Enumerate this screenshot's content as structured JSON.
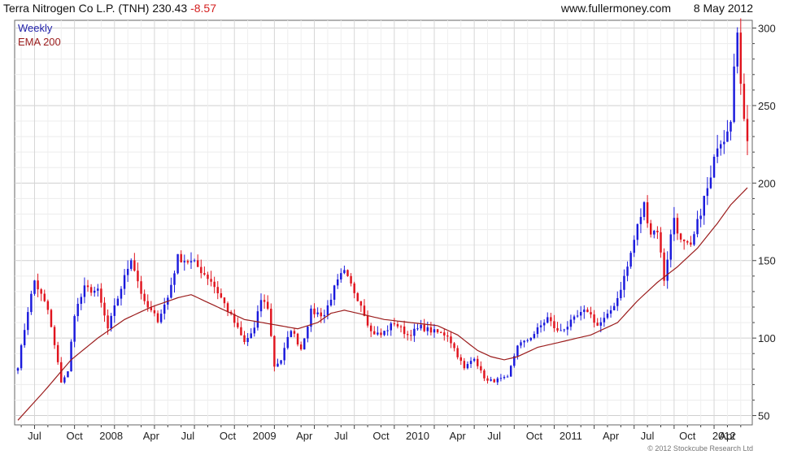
{
  "header": {
    "title": "Terra Nitrogen Co L.P. (TNH) 230.43",
    "change": "-8.57",
    "source": "www.fullermoney.com",
    "date": "8 May 2012"
  },
  "legend": {
    "weekly_label": "Weekly",
    "ema_label": "EMA 200"
  },
  "footer": {
    "copyright": "© 2012 Stockcube Research Ltd"
  },
  "colors": {
    "up": "#1a1adc",
    "down": "#e0141e",
    "ema": "#9b1c1c",
    "grid": "#d9d9d9",
    "axis": "#444444",
    "title_neg": "#d42020",
    "legend_weekly": "#2222aa",
    "legend_ema": "#9b1c1c"
  },
  "chart_data": {
    "type": "candlestick",
    "y_axis": {
      "min": 44,
      "max": 305,
      "ticks": [
        50,
        100,
        150,
        200,
        250,
        300
      ],
      "position": "right"
    },
    "x_axis": {
      "ticks": [
        "Jul",
        "Oct",
        "2008",
        "Apr",
        "Jul",
        "Oct",
        "2009",
        "Apr",
        "Jul",
        "Oct",
        "2010",
        "Apr",
        "Jul",
        "Oct",
        "2011",
        "Apr",
        "Jul",
        "Oct",
        "2012",
        "Apr"
      ]
    },
    "grid": true,
    "series": [
      {
        "name": "Weekly",
        "kind": "candles"
      },
      {
        "name": "EMA 200",
        "kind": "line"
      }
    ],
    "price_path": [
      [
        0,
        82
      ],
      [
        3,
        118
      ],
      [
        5,
        137
      ],
      [
        9,
        118
      ],
      [
        13,
        72
      ],
      [
        15,
        78
      ],
      [
        17,
        116
      ],
      [
        20,
        132
      ],
      [
        24,
        130
      ],
      [
        27,
        106
      ],
      [
        30,
        126
      ],
      [
        34,
        152
      ],
      [
        38,
        122
      ],
      [
        42,
        112
      ],
      [
        45,
        126
      ],
      [
        48,
        152
      ],
      [
        53,
        148
      ],
      [
        58,
        137
      ],
      [
        61,
        126
      ],
      [
        65,
        110
      ],
      [
        68,
        97
      ],
      [
        71,
        106
      ],
      [
        73,
        125
      ],
      [
        75,
        120
      ],
      [
        77,
        82
      ],
      [
        79,
        86
      ],
      [
        82,
        106
      ],
      [
        85,
        93
      ],
      [
        88,
        117
      ],
      [
        92,
        115
      ],
      [
        95,
        132
      ],
      [
        97,
        140
      ],
      [
        98,
        142
      ],
      [
        103,
        122
      ],
      [
        106,
        104
      ],
      [
        109,
        102
      ],
      [
        113,
        110
      ],
      [
        117,
        102
      ],
      [
        121,
        107
      ],
      [
        125,
        104
      ],
      [
        129,
        102
      ],
      [
        132,
        89
      ],
      [
        134,
        80
      ],
      [
        137,
        88
      ],
      [
        139,
        78
      ],
      [
        141,
        72
      ],
      [
        144,
        73
      ],
      [
        147,
        74
      ],
      [
        150,
        96
      ],
      [
        152,
        97
      ],
      [
        155,
        103
      ],
      [
        157,
        108
      ],
      [
        159,
        113
      ],
      [
        162,
        104
      ],
      [
        165,
        108
      ],
      [
        168,
        114
      ],
      [
        171,
        118
      ],
      [
        174,
        108
      ],
      [
        177,
        114
      ],
      [
        180,
        126
      ],
      [
        183,
        146
      ],
      [
        186,
        172
      ],
      [
        188,
        186
      ],
      [
        190,
        168
      ],
      [
        192,
        170
      ],
      [
        194,
        138
      ],
      [
        196,
        166
      ],
      [
        197,
        178
      ],
      [
        199,
        162
      ],
      [
        202,
        158
      ],
      [
        204,
        174
      ],
      [
        206,
        190
      ],
      [
        208,
        202
      ],
      [
        210,
        226
      ],
      [
        212,
        230
      ],
      [
        214,
        243
      ],
      [
        215,
        280
      ],
      [
        216,
        296
      ],
      [
        217,
        260
      ],
      [
        218,
        244
      ],
      [
        219,
        230
      ]
    ],
    "ema_path": [
      [
        0,
        47
      ],
      [
        8,
        66
      ],
      [
        16,
        86
      ],
      [
        24,
        100
      ],
      [
        32,
        112
      ],
      [
        40,
        120
      ],
      [
        48,
        126
      ],
      [
        52,
        128
      ],
      [
        56,
        124
      ],
      [
        62,
        118
      ],
      [
        68,
        112
      ],
      [
        76,
        109
      ],
      [
        84,
        106
      ],
      [
        90,
        110
      ],
      [
        94,
        116
      ],
      [
        98,
        118
      ],
      [
        102,
        116
      ],
      [
        110,
        112
      ],
      [
        118,
        110
      ],
      [
        126,
        108
      ],
      [
        132,
        102
      ],
      [
        138,
        92
      ],
      [
        142,
        88
      ],
      [
        146,
        86
      ],
      [
        150,
        88
      ],
      [
        156,
        94
      ],
      [
        164,
        98
      ],
      [
        172,
        102
      ],
      [
        180,
        110
      ],
      [
        186,
        124
      ],
      [
        192,
        136
      ],
      [
        198,
        146
      ],
      [
        204,
        158
      ],
      [
        210,
        174
      ],
      [
        214,
        186
      ],
      [
        219,
        197
      ]
    ]
  }
}
